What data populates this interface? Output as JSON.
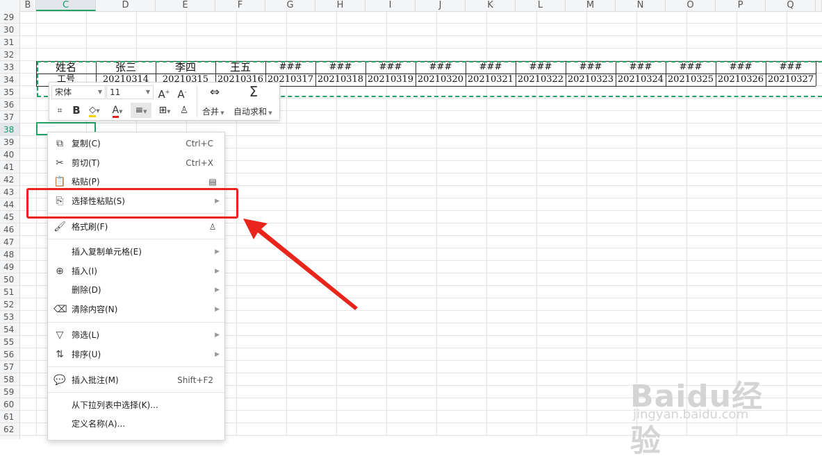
{
  "columns": [
    "B",
    "C",
    "D",
    "E",
    "F",
    "G",
    "H",
    "I",
    "J",
    "K",
    "L",
    "M",
    "N",
    "O",
    "P",
    "Q"
  ],
  "active_column": "C",
  "rows": [
    "29",
    "30",
    "31",
    "32",
    "33",
    "34",
    "35",
    "36",
    "37",
    "38",
    "39",
    "40",
    "41",
    "42",
    "43",
    "44",
    "45",
    "46",
    "47",
    "48",
    "49",
    "50",
    "51",
    "52",
    "53",
    "54",
    "55",
    "56",
    "57",
    "58",
    "59",
    "60",
    "61",
    "62"
  ],
  "active_row": "38",
  "sheet": {
    "row33": [
      "姓名",
      "张三",
      "李四",
      "王五",
      "###",
      "###",
      "###",
      "###",
      "###",
      "###",
      "###",
      "###",
      "###",
      "###",
      "###"
    ],
    "row34": [
      "工号",
      "20210314",
      "20210315",
      "20210316",
      "20210317",
      "20210318",
      "20210319",
      "20210320",
      "20210321",
      "20210322",
      "20210323",
      "20210324",
      "20210325",
      "20210326",
      "20210327"
    ]
  },
  "mini_toolbar": {
    "font_name": "宋体",
    "font_size": "11",
    "merge_label": "合并",
    "autosum_label": "自动求和"
  },
  "context_menu": {
    "copy": {
      "label": "复制(C)",
      "shortcut": "Ctrl+C"
    },
    "cut": {
      "label": "剪切(T)",
      "shortcut": "Ctrl+X"
    },
    "paste": {
      "label": "粘贴(P)"
    },
    "paste_special": {
      "label": "选择性粘贴(S)"
    },
    "format_painter": {
      "label": "格式刷(F)"
    },
    "insert_copied": {
      "label": "插入复制单元格(E)"
    },
    "insert": {
      "label": "插入(I)"
    },
    "delete": {
      "label": "删除(D)"
    },
    "clear": {
      "label": "清除内容(N)"
    },
    "filter": {
      "label": "筛选(L)"
    },
    "sort": {
      "label": "排序(U)"
    },
    "insert_comment": {
      "label": "插入批注(M)",
      "shortcut": "Shift+F2"
    },
    "pick_from_list": {
      "label": "从下拉列表中选择(K)..."
    },
    "define_name": {
      "label": "定义名称(A)..."
    }
  },
  "watermark": {
    "brand": "Baidu经验",
    "url": "jingyan.baidu.com"
  },
  "colors": {
    "accent": "#21a366",
    "annotation": "#e8241b"
  }
}
